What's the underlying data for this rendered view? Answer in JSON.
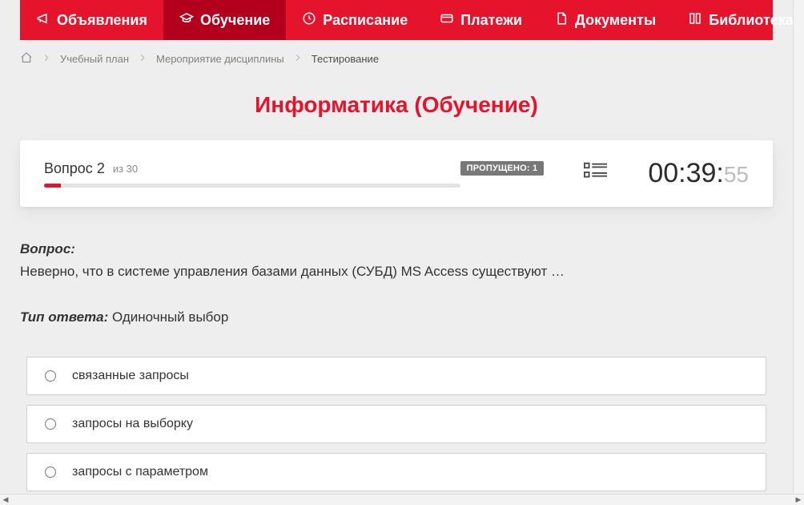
{
  "nav": {
    "items": [
      {
        "label": "Объявления",
        "icon": "megaphone"
      },
      {
        "label": "Обучение",
        "icon": "education",
        "active": true
      },
      {
        "label": "Расписание",
        "icon": "clock"
      },
      {
        "label": "Платежи",
        "icon": "payment"
      },
      {
        "label": "Документы",
        "icon": "document"
      },
      {
        "label": "Библиотека",
        "icon": "library",
        "dropdown": true
      }
    ]
  },
  "breadcrumb": {
    "items": [
      {
        "label": "Учебный план",
        "link": true
      },
      {
        "label": "Мероприятие дисциплины",
        "link": true
      },
      {
        "label": "Тестирование",
        "link": false
      }
    ]
  },
  "title": "Информатика (Обучение)",
  "status": {
    "question_label_prefix": "Вопрос",
    "question_number": "2",
    "of_label": "из 30",
    "skipped_label": "ПРОПУЩЕНО: 1",
    "timer_main": "00:39:",
    "timer_sec": "55"
  },
  "question": {
    "heading": "Вопрос:",
    "text": "Неверно, что в системе управления базами данных (СУБД) MS Access существуют …",
    "answer_type_label": "Тип ответа:",
    "answer_type_value": "Одиночный выбор"
  },
  "options": [
    {
      "label": "связанные запросы"
    },
    {
      "label": "запросы на выборку"
    },
    {
      "label": "запросы с параметром"
    }
  ]
}
